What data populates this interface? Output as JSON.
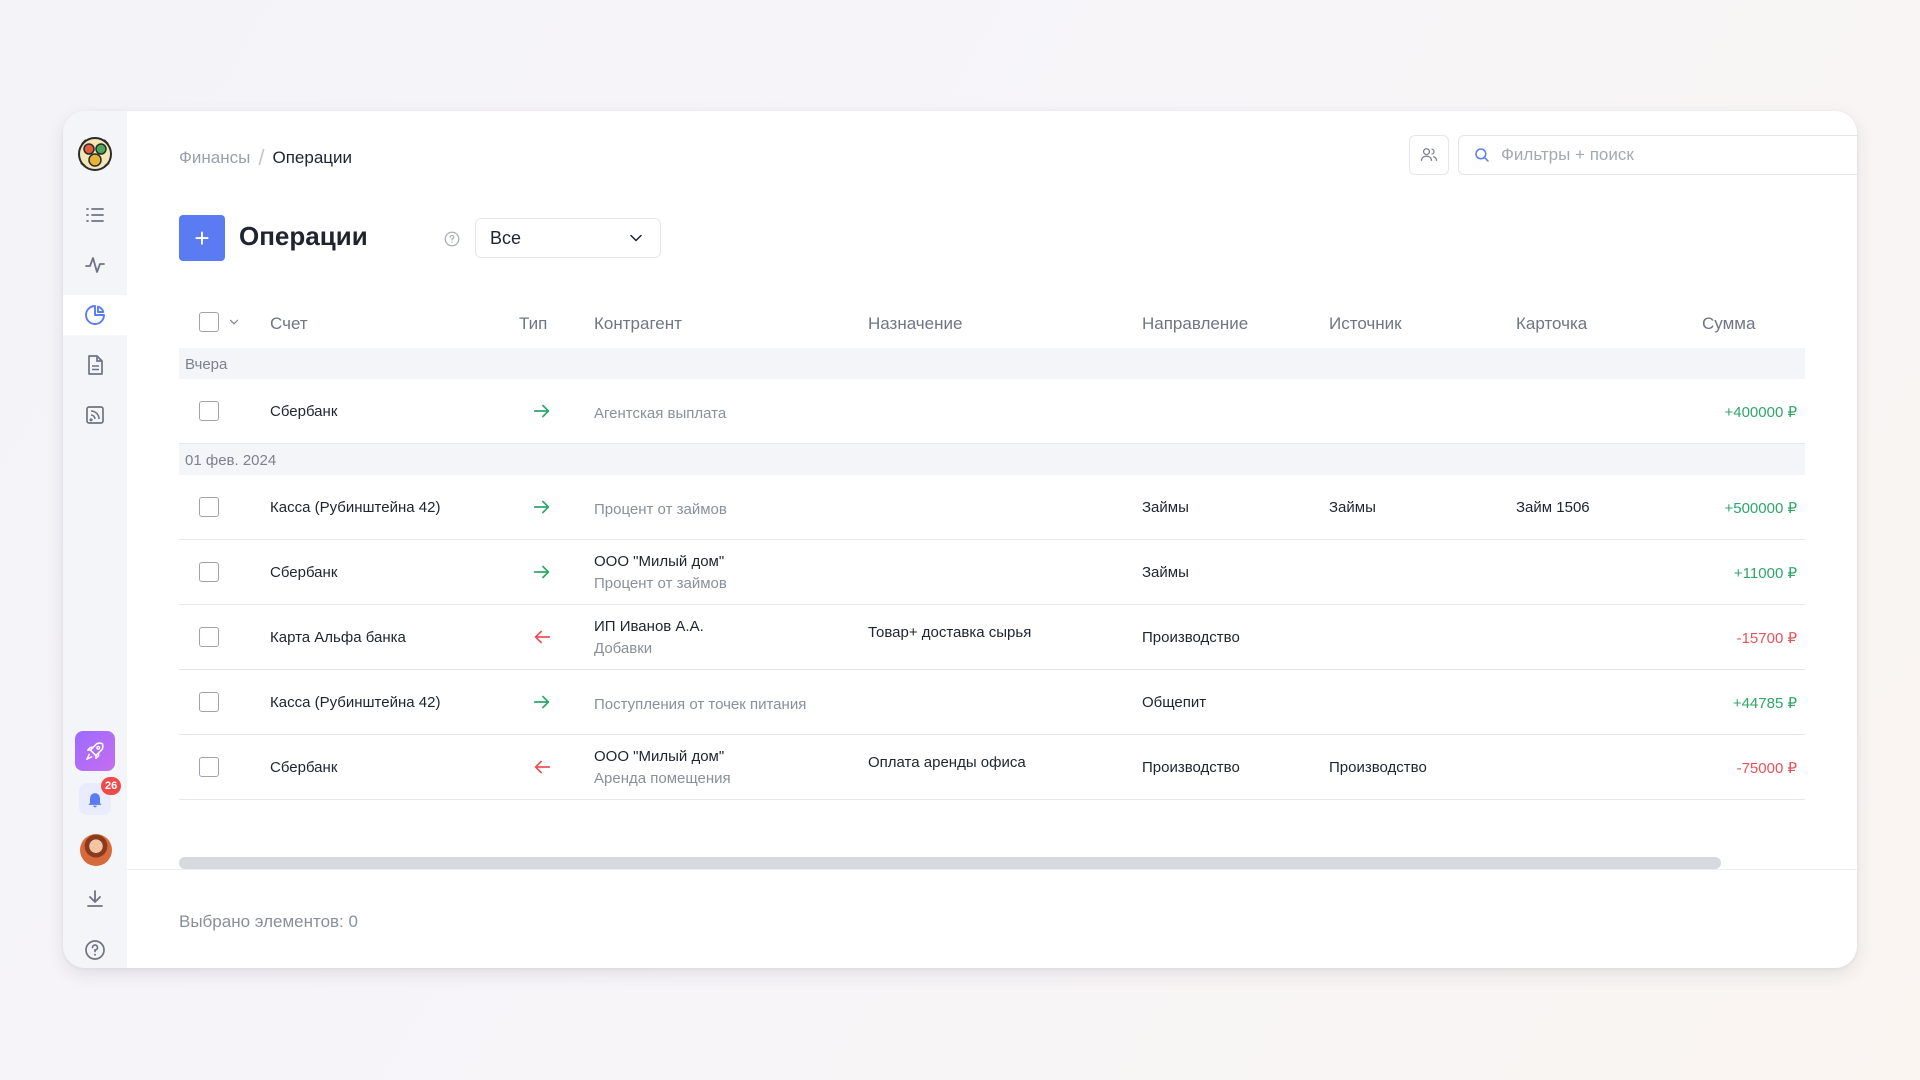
{
  "breadcrumb": {
    "parent": "Финансы",
    "separator": "/",
    "current": "Операции"
  },
  "search": {
    "placeholder": "Фильтры + поиск"
  },
  "page": {
    "title": "Операции",
    "add_label": "+"
  },
  "filter_select": {
    "value": "Все"
  },
  "table": {
    "columns": [
      "Счет",
      "Тип",
      "Контрагент",
      "Назначение",
      "Направление",
      "Источник",
      "Карточка",
      "Сумма"
    ],
    "groups": [
      {
        "label": "Вчера",
        "rows": [
          {
            "account": "Сбербанк",
            "type": "in",
            "counterparty": "",
            "counterparty_sub": "Агентская выплата",
            "purpose": "",
            "direction": "",
            "source": "",
            "card": "",
            "amount": "+400000 ₽"
          }
        ]
      },
      {
        "label": "01 фев. 2024",
        "rows": [
          {
            "account": "Касса (Рубинштейна 42)",
            "type": "in",
            "counterparty": "",
            "counterparty_sub": "Процент от займов",
            "purpose": "",
            "direction": "Займы",
            "source": "Займы",
            "card": "Займ 1506",
            "amount": "+500000 ₽"
          },
          {
            "account": "Сбербанк",
            "type": "in",
            "counterparty": "ООО \"Милый дом\"",
            "counterparty_sub": "Процент от займов",
            "purpose": "",
            "direction": "Займы",
            "source": "",
            "card": "",
            "amount": "+11000 ₽"
          },
          {
            "account": "Карта Альфа банка",
            "type": "out",
            "counterparty": "ИП Иванов А.А.",
            "counterparty_sub": "Добавки",
            "purpose": "Товар+ доставка сырья",
            "direction": "Производство",
            "source": "",
            "card": "",
            "amount": "-15700 ₽"
          },
          {
            "account": "Касса (Рубинштейна 42)",
            "type": "in",
            "counterparty": "",
            "counterparty_sub": "Поступления от точек питания",
            "purpose": "",
            "direction": "Общепит",
            "source": "",
            "card": "",
            "amount": "+44785 ₽"
          },
          {
            "account": "Сбербанк",
            "type": "out",
            "counterparty": "ООО \"Милый дом\"",
            "counterparty_sub": "Аренда помещения",
            "purpose": "Оплата аренды офиса",
            "direction": "Производство",
            "source": "Производство",
            "card": "",
            "amount": "-75000 ₽"
          }
        ]
      }
    ]
  },
  "footer": {
    "selected_text": "Выбрано элементов: 0"
  },
  "notifications": {
    "count": "26"
  },
  "colors": {
    "accent": "#5b7bf2",
    "positive": "#2fa66a",
    "negative": "#e8535a",
    "sidebar_bg": "#f4f5f8"
  },
  "icons": {
    "sidebar": [
      "list-icon",
      "activity-icon",
      "pie-chart-icon",
      "document-icon",
      "report-icon"
    ],
    "bottom": [
      "rocket-icon",
      "bell-icon",
      "avatar",
      "download-icon",
      "help-icon"
    ]
  }
}
